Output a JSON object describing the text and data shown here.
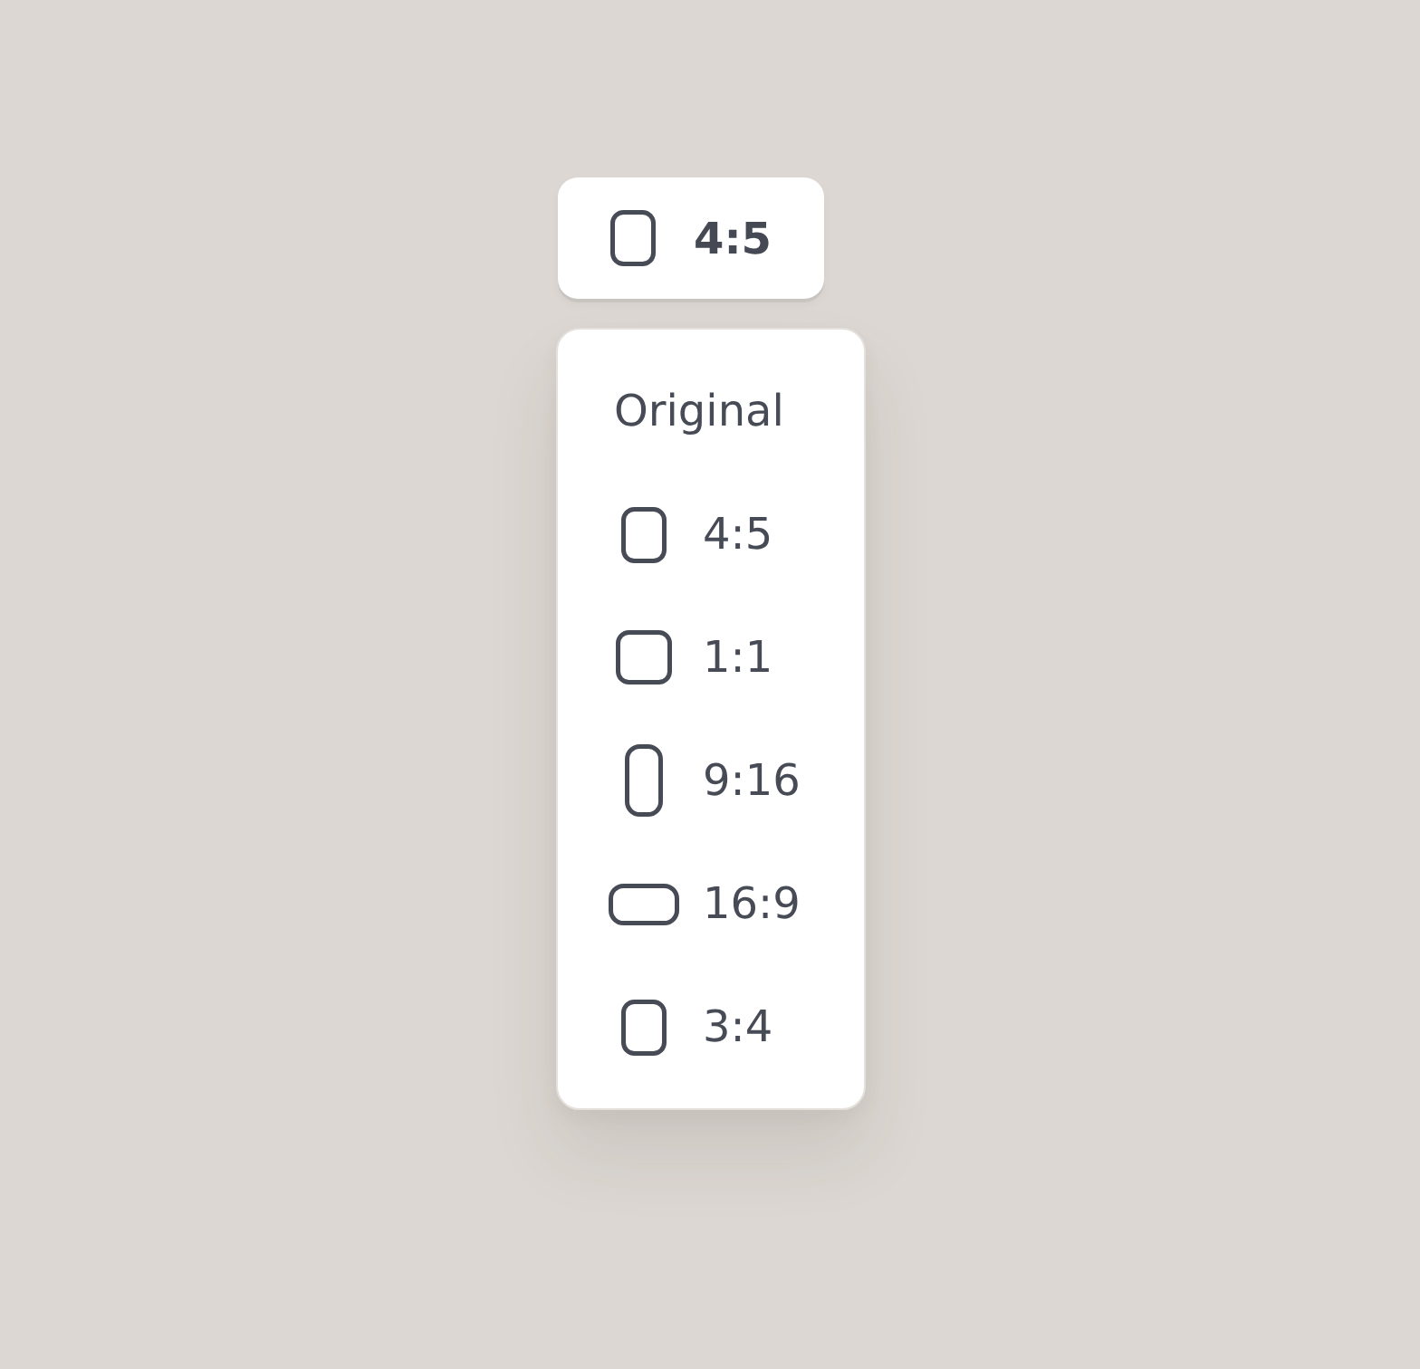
{
  "aspect_button": {
    "kind": "portrait",
    "label": "4:5"
  },
  "menu": {
    "items": [
      {
        "kind": "none",
        "label": "Original"
      },
      {
        "kind": "portrait",
        "label": "4:5"
      },
      {
        "kind": "square",
        "label": "1:1"
      },
      {
        "kind": "tall",
        "label": "9:16"
      },
      {
        "kind": "wide",
        "label": "16:9"
      },
      {
        "kind": "portrait",
        "label": "3:4"
      }
    ]
  }
}
